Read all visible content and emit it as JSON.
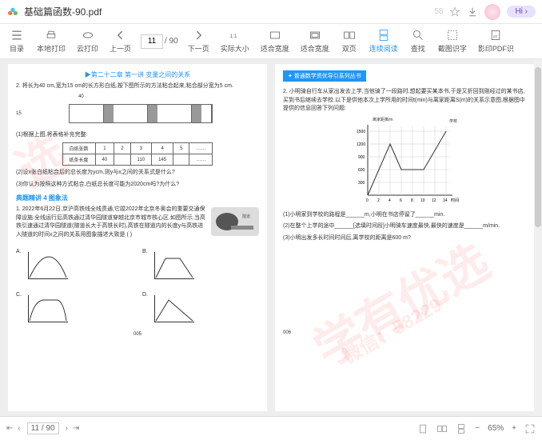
{
  "title": "基础篇函数-90.pdf",
  "hi_label": "Hi ›",
  "star_num": "58",
  "toolbar": [
    {
      "label": "目录",
      "icon": "list"
    },
    {
      "label": "本地打印",
      "icon": "print"
    },
    {
      "label": "云打印",
      "icon": "cloud"
    },
    {
      "label": "上一页",
      "icon": "prev"
    },
    {
      "label": "下一页",
      "icon": "next"
    },
    {
      "label": "实际大小",
      "icon": "1:1"
    },
    {
      "label": "适合宽度",
      "icon": "fitw"
    },
    {
      "label": "适合宽度",
      "icon": "fitw2"
    },
    {
      "label": "双页",
      "icon": "dual"
    },
    {
      "label": "连续阅读",
      "icon": "cont",
      "active": true
    },
    {
      "label": "查找",
      "icon": "find"
    },
    {
      "label": "截图识字",
      "icon": "snap"
    },
    {
      "label": "影印PDF识",
      "icon": "ocr"
    }
  ],
  "page_current": "11",
  "page_total": "/ 90",
  "chapter": "▶第二十二章 第一讲 变量之间的关系",
  "p_left": {
    "q2": "2. 将长为40 cm,宽为15 cm的长方形白纸,按下图所示的方法粘合起来,粘合部分宽为5 cm.",
    "arrow40": "40",
    "h15": "15",
    "fill": "(1)根据上图,将表格补充完整:",
    "tbl_hdr": [
      "白纸张数",
      "1",
      "2",
      "3",
      "4",
      "5",
      "……"
    ],
    "tbl_row": [
      "纸条长度",
      "40",
      "",
      "110",
      "145",
      "",
      "……"
    ],
    "q2b": "(2)设x张白纸粘合后的总长度为ycm,则y与x之间的关系式是什么?",
    "q2c": "(3)你认为按照这种方式粘合,白纸总长度可能为2020cm吗?为什么?",
    "section": "典题精讲 4 图象法",
    "story": "1. 2022年6月22日,京沪高铁线全线贯通,它竣2022年北京冬奥会的重要交通保障设施.全线运行后高铁通过清华园隧道穿越北京市城市核心区.如图所示,当高铁引速通过清华园隧道(隧道长大于高铁长时),高铁在隧道内的长度y与高铁进入隧道的时间x之间的关系用图象描述大致是         ( )",
    "labels": [
      "A.",
      "B.",
      "C.",
      "D."
    ],
    "pnum": "005"
  },
  "p_right": {
    "hdr": "✦ 普通数学资优导引系列丛书",
    "q2": "2. 小明骑自行车从家出发去上学,当他骑了一段路时,想起要买某本书,于是又折回到刚经过的某书店,买到书后继续去学校.以下是供他本次上学所用的时间t(min)与离家距离S(m)的关系示意图,根据图中提供的信息回答下列问题:",
    "y_label": "离家距离/m",
    "school": "学校",
    "q_a": "(1)小明家到学校的路程是______m,小明在书店停留了______min.",
    "q_b": "(2)在整个上学的途中______[选填时间段]小明骑车速度最快,最快的速度是______m/min.",
    "q_c": "(3)小明出发多长时间时间后,离学校的距离是600 m?",
    "pnum": "006"
  },
  "chart_data": {
    "type": "line",
    "title": "离家距离/m",
    "x": [
      0,
      2,
      4,
      6,
      8,
      10,
      12,
      14
    ],
    "y": [
      0,
      1200,
      600,
      600,
      1500
    ],
    "x_points": [
      0,
      4,
      6,
      10,
      14
    ],
    "xlim": [
      0,
      14
    ],
    "ylim": [
      0,
      1500
    ],
    "xlabel": "时间/min",
    "ylabel": "离家距离/m",
    "y_ticks": [
      300,
      600,
      900,
      1200,
      1500
    ]
  },
  "footer": {
    "pg": "11 / 90",
    "zoom": "65%"
  }
}
